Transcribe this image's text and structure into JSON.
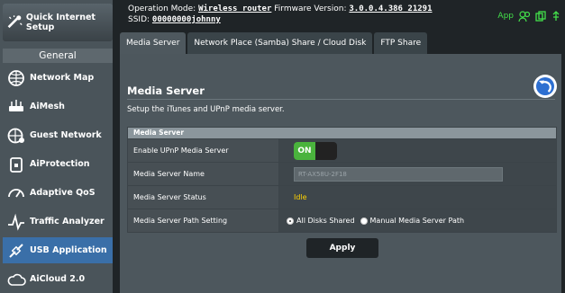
{
  "sidebar": {
    "quick_internet": "Quick Internet Setup",
    "general": "General",
    "items": [
      {
        "label": "Network Map"
      },
      {
        "label": "AiMesh"
      },
      {
        "label": "Guest Network"
      },
      {
        "label": "AiProtection"
      },
      {
        "label": "Adaptive QoS"
      },
      {
        "label": "Traffic Analyzer"
      },
      {
        "label": "USB Application"
      },
      {
        "label": "AiCloud 2.0"
      }
    ]
  },
  "header": {
    "op_mode_label": "Operation Mode:",
    "op_mode_value": "Wireless router",
    "fw_label": "Firmware Version:",
    "fw_value": "3.0.0.4.386_21291",
    "ssid_label": "SSID:",
    "ssid_value": "00000000johnny",
    "app_label": "App"
  },
  "tabs": [
    {
      "label": "Media Server"
    },
    {
      "label": "Network Place (Samba) Share / Cloud Disk"
    },
    {
      "label": "FTP Share"
    }
  ],
  "page": {
    "title": "Media Server",
    "description": "Setup the iTunes and UPnP media server."
  },
  "table": {
    "header": "Media Server",
    "rows": [
      {
        "label": "Enable UPnP Media Server",
        "toggle": "ON"
      },
      {
        "label": "Media Server Name",
        "value": "RT-AX58U-2F18"
      },
      {
        "label": "Media Server Status",
        "value": "Idle"
      },
      {
        "label": "Media Server Path Setting",
        "opt1": "All Disks Shared",
        "opt2": "Manual Media Server Path"
      }
    ]
  },
  "apply_label": "Apply"
}
